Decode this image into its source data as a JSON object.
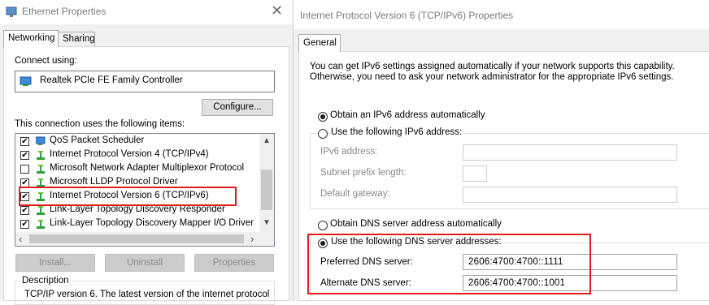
{
  "left_window": {
    "title": "Ethernet Properties",
    "tabs": [
      "Networking",
      "Sharing"
    ],
    "connect_using_label": "Connect using:",
    "adapter_name": "Realtek PCIe FE Family Controller",
    "configure_button": "Configure...",
    "items_label": "This connection uses the following items:",
    "items": [
      {
        "label": "QoS Packet Scheduler",
        "checked": true,
        "icon": "scheduler-icon"
      },
      {
        "label": "Internet Protocol Version 4 (TCP/IPv4)",
        "checked": true,
        "icon": "network-protocol-icon"
      },
      {
        "label": "Microsoft Network Adapter Multiplexor Protocol",
        "checked": false,
        "icon": "network-protocol-icon"
      },
      {
        "label": "Microsoft LLDP Protocol Driver",
        "checked": true,
        "icon": "network-protocol-icon"
      },
      {
        "label": "Internet Protocol Version 6 (TCP/IPv6)",
        "checked": true,
        "icon": "network-protocol-icon"
      },
      {
        "label": "Link-Layer Topology Discovery Responder",
        "checked": true,
        "icon": "network-protocol-icon"
      },
      {
        "label": "Link-Layer Topology Discovery Mapper I/O Driver",
        "checked": true,
        "icon": "network-protocol-icon"
      }
    ],
    "install_button": "Install...",
    "uninstall_button": "Uninstall",
    "properties_button": "Properties",
    "description_label": "Description",
    "description_text": "TCP/IP version 6. The latest version of the internet protocol"
  },
  "right_window": {
    "title": "Internet Protocol Version 6 (TCP/IPv6) Properties",
    "tab": "General",
    "intro_line1": "You can get IPv6 settings assigned automatically if your network supports this capability.",
    "intro_line2": "Otherwise, you need to ask your network administrator for the appropriate IPv6 settings.",
    "obtain_ip_auto": "Obtain an IPv6 address automatically",
    "use_following_ip": "Use the following IPv6 address:",
    "ipv6_address_label": "IPv6 address:",
    "subnet_prefix_label": "Subnet prefix length:",
    "default_gateway_label": "Default gateway:",
    "obtain_dns_auto": "Obtain DNS server address automatically",
    "use_following_dns": "Use the following DNS server addresses:",
    "preferred_dns_label": "Preferred DNS server:",
    "preferred_dns_value": "2606:4700:4700::1111",
    "alternate_dns_label": "Alternate DNS server:",
    "alternate_dns_value": "2606:4700:4700::1001",
    "highlight_color": "#e11b1b"
  }
}
